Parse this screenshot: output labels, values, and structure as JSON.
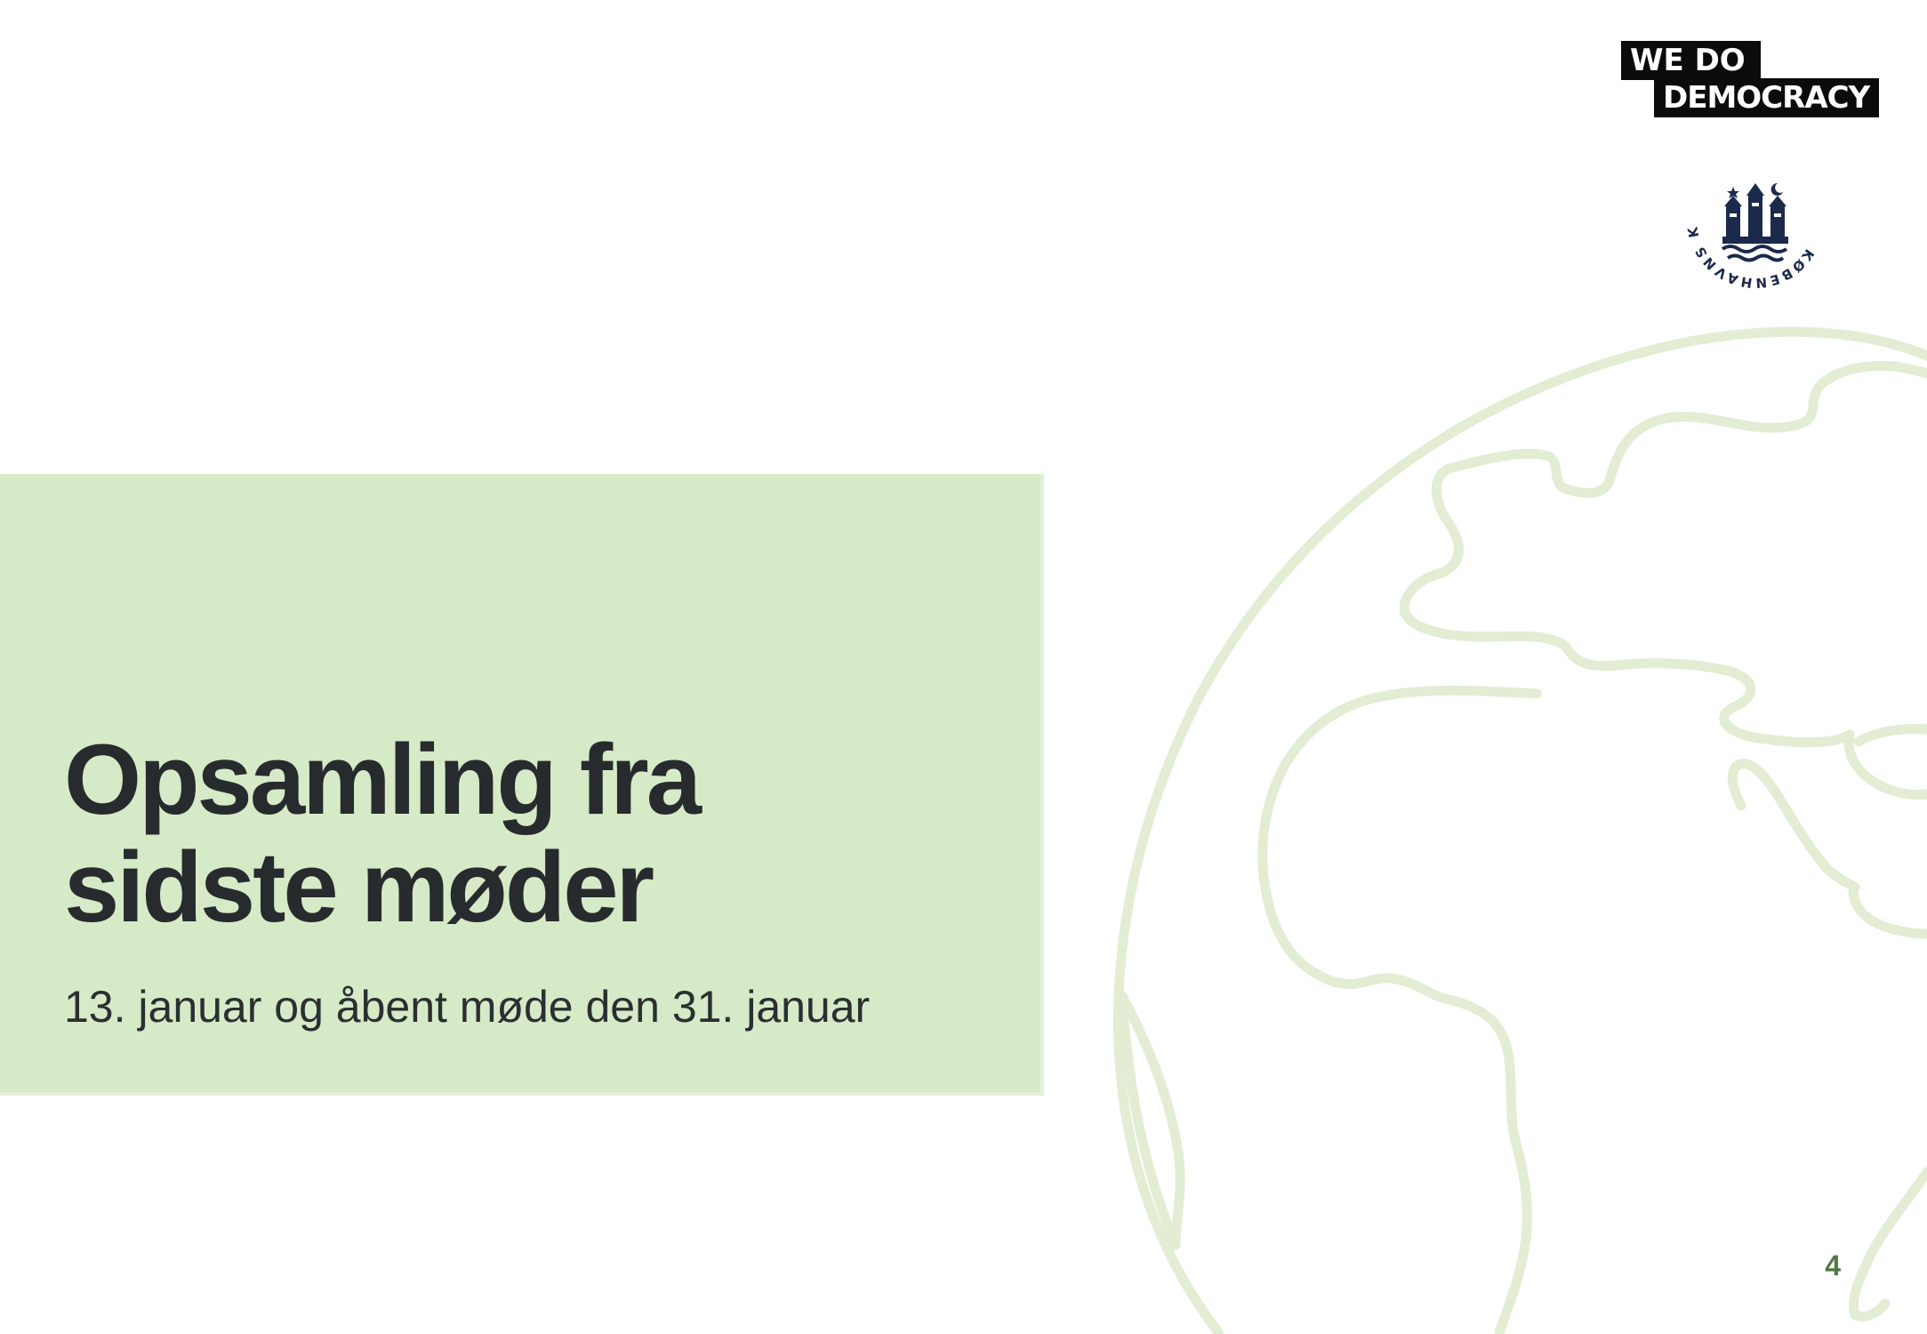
{
  "slide": {
    "title_line1": "Opsamling fra",
    "title_line2": "sidste møder",
    "subtitle": "13. januar og åbent møde den 31. januar",
    "page_number": "4"
  },
  "logos": {
    "we_do_democracy": {
      "line1": "WE DO",
      "line2": "DEMOCRACY"
    },
    "kobenhavns_kommune": {
      "text": "KØBENHAVNS KOMMUNE"
    }
  },
  "colors": {
    "title_box": "#d6eac7",
    "globe_outline": "#e2edd4",
    "title_text": "#272b2e",
    "page_number": "#4f7a45",
    "seal": "#1b2a4a"
  },
  "icons": {
    "globe": "globe-outline-icon",
    "seal": "copenhagen-coat-of-arms-icon"
  }
}
